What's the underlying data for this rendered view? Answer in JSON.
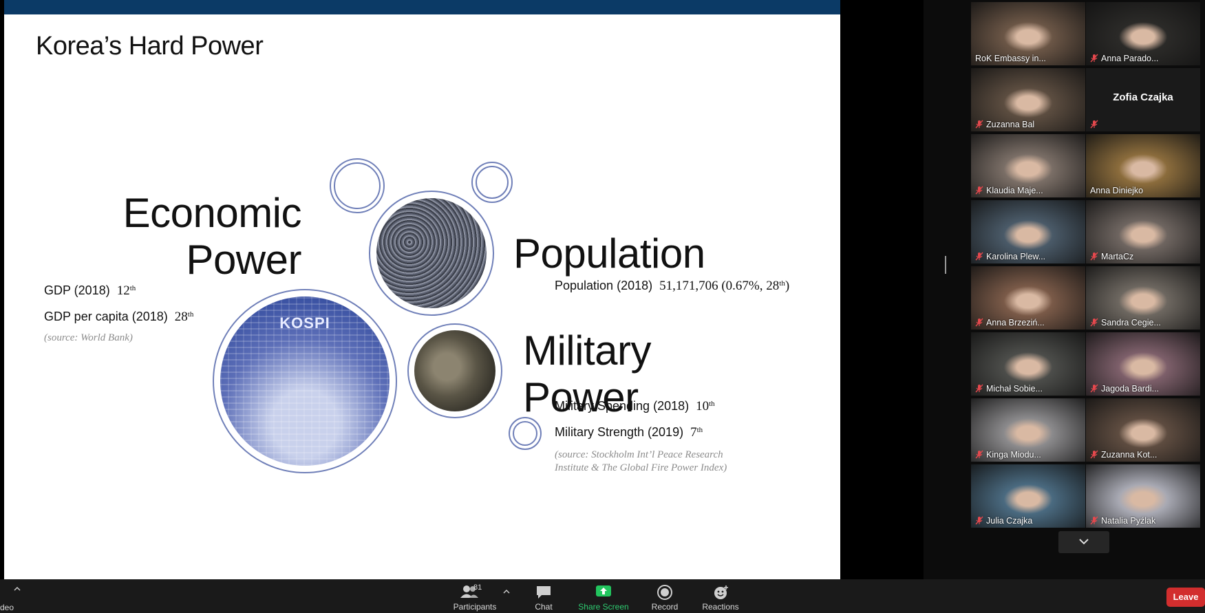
{
  "slide": {
    "title": "Korea’s Hard Power",
    "economic": {
      "heading": "Economic\nPower",
      "gdp_label": "GDP (2018)",
      "gdp_value": "12",
      "gdp_suffix": "th",
      "gdp_pc_label": "GDP per capita (2018)",
      "gdp_pc_value": "28",
      "gdp_pc_suffix": "th",
      "source": "(source: World Bank)",
      "image_label": "KOSPI"
    },
    "population": {
      "heading": "Population",
      "label": "Population (2018)",
      "value_main": "51,171,706 (0.67%, 28",
      "value_suffix": "th",
      "value_close": ")"
    },
    "military": {
      "heading": "Military\nPower",
      "spending_label": "Military Spending (2018)",
      "spending_value": "10",
      "spending_suffix": "th",
      "strength_label": "Military Strength (2019)",
      "strength_value": "7",
      "strength_suffix": "th",
      "source_line1": "(source: Stockholm Int’l Peace Research",
      "source_line2": "Institute & The Global Fire Power Index)"
    },
    "colors": {
      "topbar": "#0b3a66",
      "ring": "#4f63a8"
    }
  },
  "participants": [
    {
      "name": "RoK Embassy in...",
      "muted": false,
      "active": true,
      "bg": "#6b5646"
    },
    {
      "name": "Anna Parado...",
      "muted": true,
      "active": false,
      "bg": "#2b2a28"
    },
    {
      "name": "Zuzanna Bal",
      "muted": true,
      "active": false,
      "bg": "#5c4d40"
    },
    {
      "name": "Zofia Czajka",
      "muted": true,
      "active": false,
      "bg": "#1a1a1a",
      "no_video": true
    },
    {
      "name": "Klaudia Maje...",
      "muted": true,
      "active": false,
      "bg": "#7a6e66"
    },
    {
      "name": "Anna Diniejko",
      "muted": false,
      "active": false,
      "bg": "#8b6c3c"
    },
    {
      "name": "Karolina Plew...",
      "muted": true,
      "active": false,
      "bg": "#4a5a68"
    },
    {
      "name": "MartaCz",
      "muted": true,
      "active": false,
      "bg": "#6e6560"
    },
    {
      "name": "Anna Brzeziń...",
      "muted": true,
      "active": false,
      "bg": "#7a5a48"
    },
    {
      "name": "Sandra Cegie...",
      "muted": true,
      "active": false,
      "bg": "#6d6760"
    },
    {
      "name": "Michał Sobie...",
      "muted": true,
      "active": false,
      "bg": "#4c4d4a"
    },
    {
      "name": "Jagoda Bardi...",
      "muted": true,
      "active": false,
      "bg": "#7d5f6a"
    },
    {
      "name": "Kinga Miodu...",
      "muted": true,
      "active": false,
      "bg": "#8b8a8c"
    },
    {
      "name": "Zuzanna Kot...",
      "muted": true,
      "active": false,
      "bg": "#5e4c40"
    },
    {
      "name": "Julia Czajka",
      "muted": true,
      "active": false,
      "bg": "#4a6a80"
    },
    {
      "name": "Natalia Pyźlak",
      "muted": true,
      "active": false,
      "bg": "#a8a9b3"
    }
  ],
  "toolbar": {
    "video_label": "deo",
    "participants_label": "Participants",
    "participants_count": "81",
    "chat_label": "Chat",
    "share_label": "Share Screen",
    "record_label": "Record",
    "reactions_label": "Reactions",
    "leave_label": "Leave"
  }
}
